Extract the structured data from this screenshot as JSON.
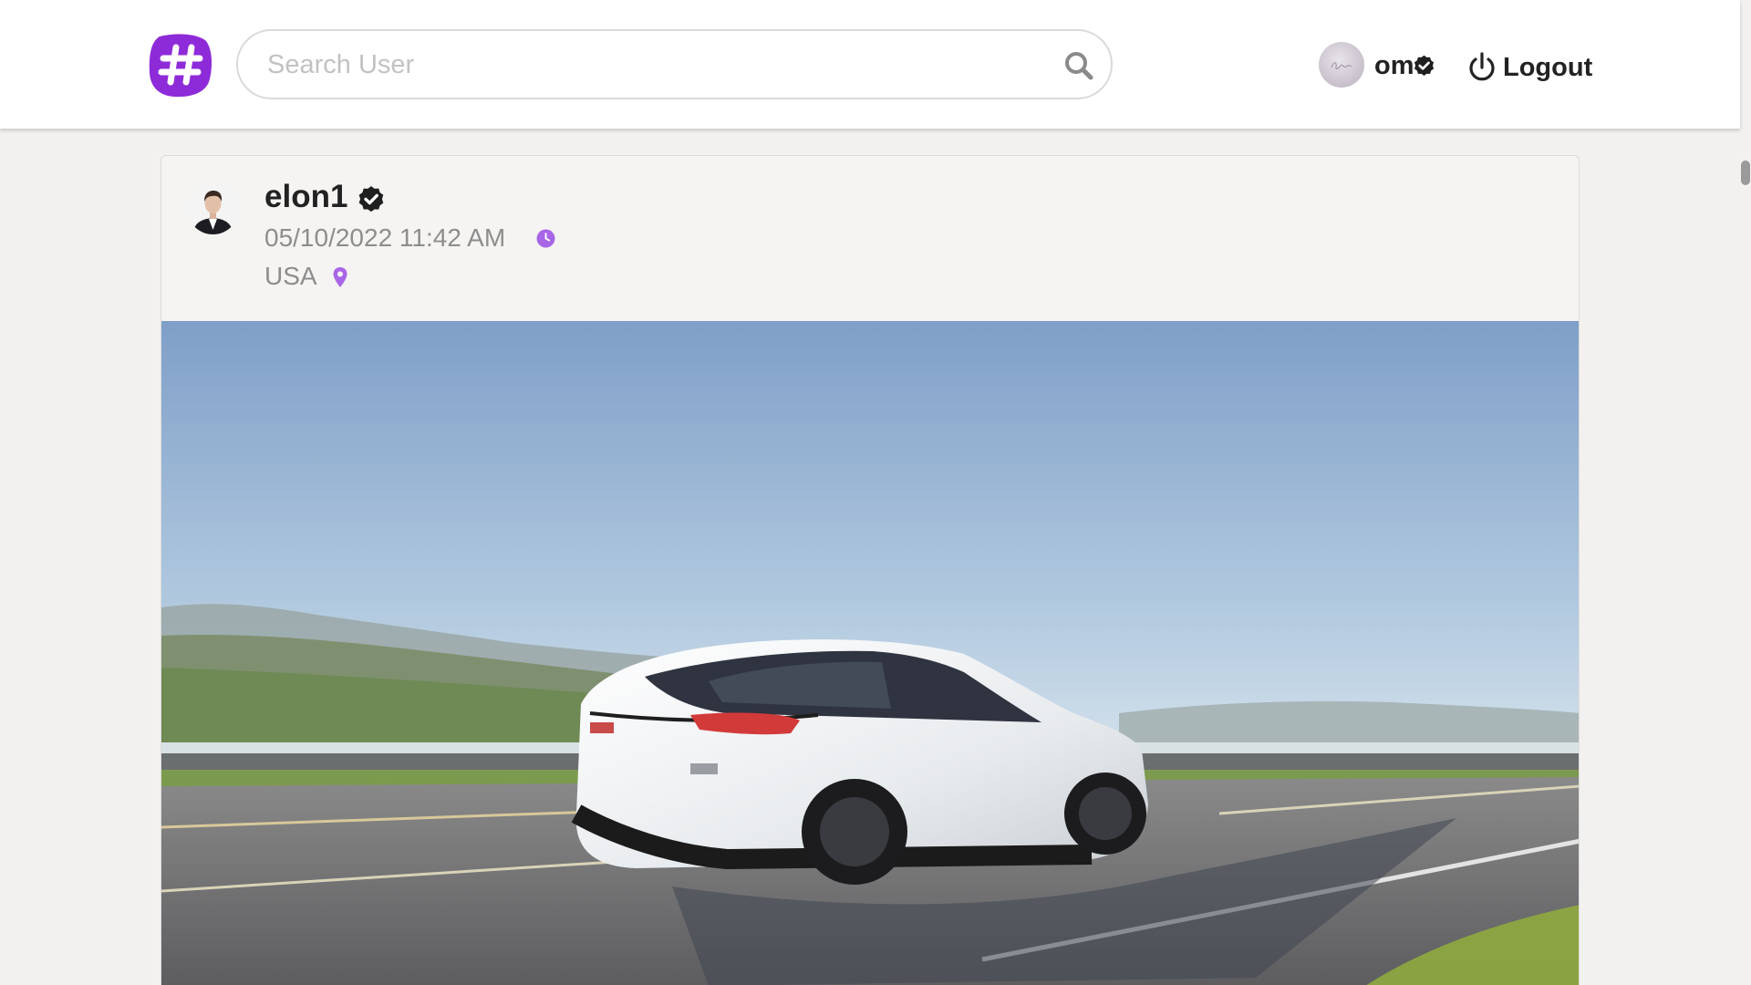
{
  "app": {
    "logo_icon": "hashtag-logo-icon",
    "brand_color": "#8e2bd9"
  },
  "search": {
    "placeholder": "Search User",
    "value": "",
    "icon": "search-icon"
  },
  "current_user": {
    "name": "om",
    "verified": true,
    "logout_label": "Logout"
  },
  "post": {
    "author": "elon1",
    "verified": true,
    "date": "05/10/2022 11:42 AM",
    "location": "USA",
    "accent_color": "#a866e6",
    "image_alt": "white car on a coastal road"
  }
}
